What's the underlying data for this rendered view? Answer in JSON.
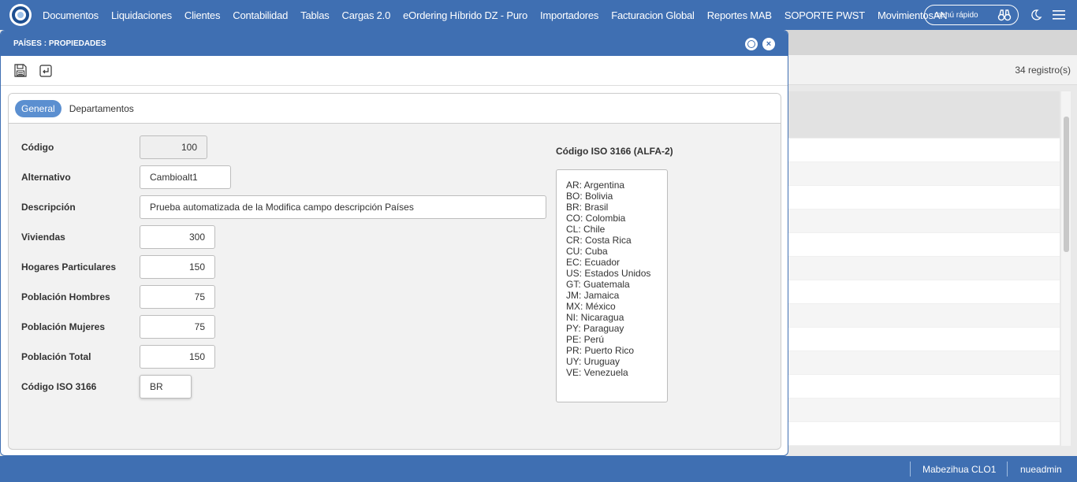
{
  "nav": {
    "items": [
      "Documentos",
      "Liquidaciones",
      "Clientes",
      "Contabilidad",
      "Tablas",
      "Cargas 2.0",
      "eOrdering Híbrido DZ - Puro",
      "Importadores",
      "Facturacion Global",
      "Reportes MAB",
      "SOPORTE PWST",
      "MovimientosAN"
    ],
    "quick_menu": "menú rápido"
  },
  "background": {
    "records": "34 registro(s)"
  },
  "dialog": {
    "title": "PAÍSES : PROPIEDADES",
    "tabs": [
      "General",
      "Departamentos"
    ],
    "fields": [
      {
        "label": "Código",
        "value": "100"
      },
      {
        "label": "Alternativo",
        "value": "Cambioalt1"
      },
      {
        "label": "Descripción",
        "value": "Prueba automatizada de la Modifica campo descripción Países"
      },
      {
        "label": "Viviendas",
        "value": "300"
      },
      {
        "label": "Hogares Particulares",
        "value": "150"
      },
      {
        "label": "Población Hombres",
        "value": "75"
      },
      {
        "label": "Población Mujeres",
        "value": "75"
      },
      {
        "label": "Población Total",
        "value": "150"
      },
      {
        "label": "Código ISO 3166",
        "value": "BR"
      }
    ],
    "iso": {
      "title": "Código ISO 3166 (ALFA-2)",
      "items": [
        "AR: Argentina",
        "BO: Bolivia",
        "BR: Brasil",
        "CO: Colombia",
        "CL: Chile",
        "CR: Costa Rica",
        "CU: Cuba",
        "EC: Ecuador",
        "US: Estados Unidos",
        "GT: Guatemala",
        "JM: Jamaica",
        "MX: México",
        "NI: Nicaragua",
        "PY: Paraguay",
        "PE: Perú",
        "PR: Puerto Rico",
        "UY: Uruguay",
        "VE: Venezuela"
      ]
    }
  },
  "footer": {
    "company": "Mabezihua CLO1",
    "user": "nueadmin"
  }
}
